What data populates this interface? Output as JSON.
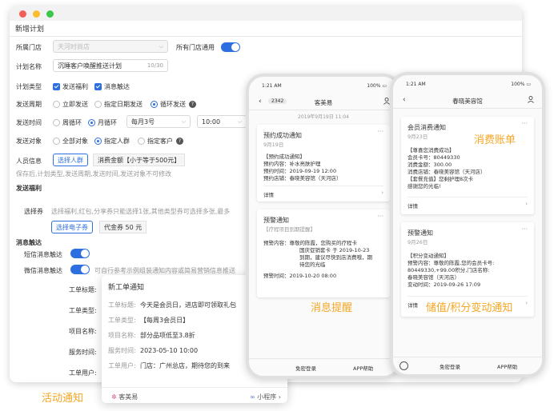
{
  "window": {
    "title": "新增计划"
  },
  "form": {
    "store_label": "所属门店",
    "store_value": "天河时尚店",
    "all_store_label": "所有门店通用",
    "plan_name_label": "计划名称",
    "plan_name_value": "沉睡客户唤醒推送计划",
    "plan_name_count": "10/30",
    "plan_type_label": "计划类型",
    "plan_type_opt1": "发送福利",
    "plan_type_opt2": "消息触达",
    "cycle_label": "发送周期",
    "cycle_opt1": "立即发送",
    "cycle_opt2": "指定日期发送",
    "cycle_opt3": "循环发送",
    "time_label": "发送时间",
    "time_opt1": "周循环",
    "time_opt2": "月循环",
    "time_day": "每月3号",
    "time_clock": "10:00",
    "target_label": "发送对象",
    "target_opt1": "全部对象",
    "target_opt2": "指定人群",
    "target_opt3": "指定客户",
    "crowd_label": "人员信息",
    "crowd_button": "选择人群",
    "crowd_tag": "消费金额【小于等于500元】",
    "save_hint": "保存后,计划类型,发送周期,发送时间,发送对象不可修改",
    "welfare_section": "发送福利",
    "coupon_label": "选择券",
    "coupon_hint": "选择福利,红包,分享券只能选择1张,其他类型券可选择多张,最多",
    "coupon_button": "选择电子券",
    "coupon_tag": "代金券 50 元",
    "msg_section": "消息触达",
    "sms_label": "短信消息触达",
    "wechat_label": "微信消息触达",
    "wechat_hint": "可自行参考示例组装通知内容或简易营销信息推送",
    "order_title_label": "工单标题:",
    "order_type_label": "工单类型:",
    "item_name_label": "项目名称:",
    "service_time_label": "服务时间:",
    "order_user_label": "工单用户:"
  },
  "popup": {
    "title": "新工单通知",
    "rows": [
      {
        "k": "工单标题:",
        "v": "今天是会员日，进店即可领取礼包"
      },
      {
        "k": "工单类型:",
        "v": "【每周3会员日】"
      },
      {
        "k": "项目名称:",
        "v": "部分品项低至3.8折"
      },
      {
        "k": "服务时间:",
        "v": "2023-05-10  10:00"
      },
      {
        "k": "工单用户:",
        "v": "门店：广州总店，期待您的到来"
      }
    ],
    "brand": "客美易",
    "mini_program": "小程序"
  },
  "phone1": {
    "time": "1:21 AM",
    "battery": "100%",
    "badge": "2342",
    "title": "客美易",
    "date": "2019年9月19日 11:04",
    "card1": {
      "title": "预约成功通知",
      "sub": "9月19日",
      "lines": [
        "【预约成功通知】",
        "预约内容：补水亮肤护理",
        "预约时间：2019-09-19 12:00",
        "预约店铺：春晓美容馆（天河店）"
      ],
      "detail": "详情"
    },
    "card2": {
      "title": "预警通知",
      "sub": "【疗程项目到期提醒】",
      "lines": [
        "预警内容：尊敬的陈霞，您购买的疗程卡",
        "国庆促销套卡 于 2019-10-23",
        "到期，建议尽快到店消费哦，期",
        "待您的光临",
        "预警时间：2019-10-20 08:00"
      ],
      "detail": "详情"
    },
    "foot1": "免密登录",
    "foot2": "APP帮助"
  },
  "phone2": {
    "time": "1:21 AM",
    "battery": "100%",
    "title": "春晓美容馆",
    "card1": {
      "title": "会员消费通知",
      "sub": "9月23日",
      "lines": [
        "【尊喜您消费成功】",
        "会员卡号：80449330",
        "消费金额：300.00",
        "消费店铺：春晓美容馆（天河店）",
        "【套餐充值】您剩护理8次卡",
        "感谢您的光临!"
      ],
      "detail": "详情"
    },
    "card2": {
      "title": "预警通知",
      "sub": "9月26日",
      "lines": [
        "【积分变动通知】",
        "预警内容：尊敬的陈霞,您的会员卡号:",
        "80449330,+99.00积分,门店名称:",
        "春晓美容馆（天河店）",
        "变动时间：2019-09-26 17:09"
      ],
      "detail": "详情"
    },
    "foot1": "免密登录",
    "foot2": "APP帮助"
  },
  "annotations": {
    "activity": "活动通知",
    "message": "消息提醒",
    "bill": "消费账单",
    "points": "储值/积分变动通知"
  },
  "colors": {
    "accent": "#2d6ee0",
    "orange": "#f5a623"
  }
}
